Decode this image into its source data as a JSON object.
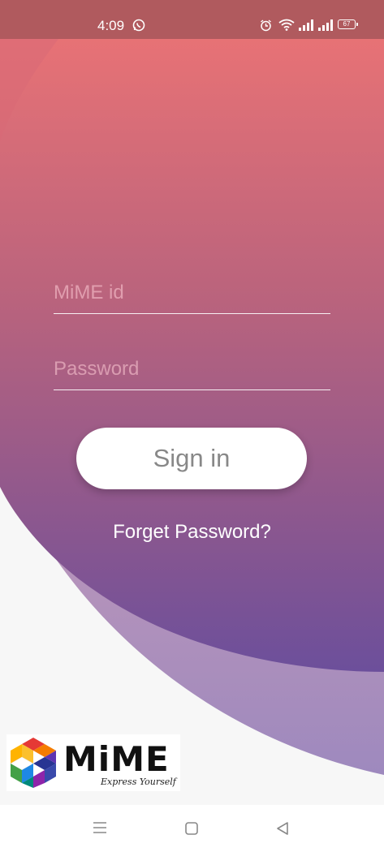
{
  "status_bar": {
    "time": "4:09",
    "battery": "67",
    "icons": [
      "whatsapp-icon",
      "alarm-icon",
      "wifi-icon",
      "signal-icon",
      "signal-icon",
      "battery-icon"
    ]
  },
  "login": {
    "mime_id_placeholder": "MiME id",
    "mime_id_value": "",
    "password_placeholder": "Password",
    "password_value": "",
    "sign_in_label": "Sign in",
    "forget_password_label": "Forget Password?"
  },
  "logo": {
    "wordmark": "MiME",
    "tagline": "Express Yourself"
  },
  "nav_bar": {
    "icons": [
      "menu-icon",
      "home-square-icon",
      "back-triangle-icon"
    ]
  },
  "colors": {
    "gradient_top": "#ee7474",
    "gradient_mid": "#b1637f",
    "gradient_bottom": "#70509a",
    "lavender_band": "#a48fbe",
    "status_bar": "#b05a5e",
    "background": "#f7f7f7"
  }
}
